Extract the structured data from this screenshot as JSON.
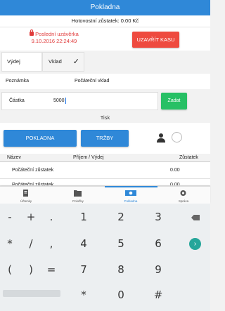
{
  "app": {
    "title": "Pokladna"
  },
  "balance_text": "Hotovostní zůstatek: 0.00 Kč",
  "last_close": {
    "line1": "Poslední uzávěrka",
    "line2": "9.10.2016 22:24:49"
  },
  "close_button": "UZAVŘÍT KASU",
  "toggle": {
    "left": "Výdej",
    "right": "Vklad",
    "selected": "Vklad"
  },
  "note": {
    "label": "Poznámka",
    "value": "Počáteční vklad"
  },
  "amount": {
    "label": "Částka",
    "value": "5000"
  },
  "submit_button": "Zadat",
  "print": {
    "title": "Tisk",
    "btn_pokladna": "POKLADNA",
    "btn_trzby": "TRŽBY"
  },
  "table": {
    "headers": {
      "name": "Název",
      "in_out": "Příjem / Výdej",
      "balance": "Zůstatek"
    },
    "rows": [
      {
        "name": "Počáteční zůstatek",
        "balance": "0.00"
      },
      {
        "name": "Počáteční zůstatek",
        "balance": "0.00"
      }
    ]
  },
  "bottom_nav": [
    {
      "label": "Účtenky",
      "icon": "receipt-icon"
    },
    {
      "label": "Položky",
      "icon": "folder-icon"
    },
    {
      "label": "Pokladna",
      "icon": "cash-register-icon"
    },
    {
      "label": "Správa",
      "icon": "gear-icon"
    }
  ],
  "keyboard": {
    "rows": [
      [
        "-",
        "+",
        ".",
        "1",
        "2",
        "3"
      ],
      [
        "*",
        "/",
        ",",
        "4",
        "5",
        "6"
      ],
      [
        "(",
        ")",
        "=",
        "7",
        "8",
        "9"
      ],
      [
        "*",
        "0",
        "#"
      ]
    ]
  },
  "colors": {
    "primary": "#2f88d8",
    "danger": "#ee4a3f",
    "success": "#27c065",
    "keyboard_bg": "#eceff1"
  }
}
